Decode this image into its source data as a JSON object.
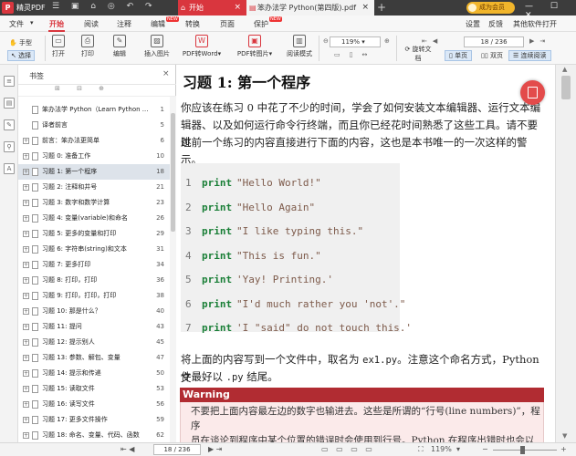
{
  "titlebar": {
    "app_logo": "P",
    "app_name": "精灵PDF",
    "tabs": [
      {
        "label": "开始",
        "close": "×"
      },
      {
        "label": "笨办法学 Python(第四版).pdf",
        "close": "×"
      }
    ],
    "new_tab": "+",
    "member_label": "成为会员",
    "window_controls": "— ☐ ✕"
  },
  "menu": {
    "items": [
      "文件",
      "开始",
      "阅读",
      "注释",
      "编辑",
      "转换",
      "页面",
      "保护"
    ],
    "right_items": [
      "设置",
      "反馈",
      "其他软件打开"
    ],
    "new_badge": "NEW"
  },
  "toolbar": {
    "hand": "手型",
    "select": "选择",
    "tools": [
      "打开",
      "打印",
      "编辑",
      "插入图片",
      "PDF转Word",
      "PDF转图片",
      "阅读模式"
    ],
    "zoom": "119%",
    "page_box": "18 / 236",
    "rotate": "旋转文档",
    "views": [
      "单页",
      "双页",
      "连续阅读"
    ]
  },
  "sidebar": {
    "title": "书签",
    "close": "×",
    "tools": "⊞ ⊟ ⊕",
    "bookmarks": [
      {
        "label": "笨办法学 Python（Learn Python ...",
        "page": "1",
        "expand": false
      },
      {
        "label": "译者前言",
        "page": "5",
        "expand": false
      },
      {
        "label": "前言：笨办法更简单",
        "page": "6",
        "expand": true
      },
      {
        "label": "习题 0: 准备工作",
        "page": "10",
        "expand": true
      },
      {
        "label": "习题 1: 第一个程序",
        "page": "18",
        "expand": true,
        "selected": true
      },
      {
        "label": "习题 2: 注释和井号",
        "page": "21",
        "expand": true
      },
      {
        "label": "习题 3: 数字和数学计算",
        "page": "23",
        "expand": true
      },
      {
        "label": "习题 4: 变量(variable)和命名",
        "page": "26",
        "expand": true
      },
      {
        "label": "习题 5: 更多的变量和打印",
        "page": "29",
        "expand": true
      },
      {
        "label": "习题 6: 字符串(string)和文本",
        "page": "31",
        "expand": true
      },
      {
        "label": "习题 7: 更多打印",
        "page": "34",
        "expand": true
      },
      {
        "label": "习题 8: 打印，打印",
        "page": "36",
        "expand": true
      },
      {
        "label": "习题 9: 打印，打印，打印",
        "page": "38",
        "expand": true
      },
      {
        "label": "习题 10: 那是什么？",
        "page": "40",
        "expand": true
      },
      {
        "label": "习题 11: 提问",
        "page": "43",
        "expand": true
      },
      {
        "label": "习题 12: 提示别人",
        "page": "45",
        "expand": true
      },
      {
        "label": "习题 13: 参数、解包、变量",
        "page": "47",
        "expand": true
      },
      {
        "label": "习题 14: 提示和传递",
        "page": "50",
        "expand": true
      },
      {
        "label": "习题 15: 读取文件",
        "page": "53",
        "expand": true
      },
      {
        "label": "习题 16: 读写文件",
        "page": "56",
        "expand": true
      },
      {
        "label": "习题 17: 更多文件操作",
        "page": "59",
        "expand": true
      },
      {
        "label": "习题 18: 命名、变量、代码、函数",
        "page": "62",
        "expand": true
      }
    ]
  },
  "document": {
    "heading": "习题 1: 第一个程序",
    "intro_lines": [
      "你应该在练习 0 中花了不少的时间，学会了如何安装文本编辑器、运行文本编",
      "辑器、以及如何运行命令行终端，而且你已经花时间熟悉了这些工具。请不要跳",
      "过前一个练习的内容直接进行下面的内容，这也是本书唯一的一次这样的警示。"
    ],
    "code_lines": [
      {
        "num": "1",
        "kw": "print",
        "str": "\"Hello World!\""
      },
      {
        "num": "2",
        "kw": "print",
        "str": "\"Hello Again\""
      },
      {
        "num": "3",
        "kw": "print",
        "str": "\"I like typing this.\""
      },
      {
        "num": "4",
        "kw": "print",
        "str": "\"This is fun.\""
      },
      {
        "num": "5",
        "kw": "print",
        "str": "'Yay! Printing.'"
      },
      {
        "num": "6",
        "kw": "print",
        "str": "\"I'd much rather you 'not'.\""
      },
      {
        "num": "7",
        "kw": "print",
        "str": "'I \"said\" do not touch this.'"
      }
    ],
    "after_line1_a": "将上面的内容写到一个文件中，取名为",
    "after_line1_code": "ex1.py",
    "after_line1_b": "。注意这个命名方式，Python 文",
    "after_line2_a": "件最好以",
    "after_line2_code": ".py",
    "after_line2_b": "结尾。",
    "warning_title": "Warning",
    "warning_lines": [
      "不要把上面内容最左边的数字也输进去。这些是所谓的“行号(line numbers)”，程序",
      "员在谈论到程序中某个位置的错误时会使用到行号。Python 在程序出错时也会以"
    ]
  },
  "statusbar": {
    "nav_left": "⇤  ◀",
    "page": "18 / 236",
    "nav_right": "▶  ⇥",
    "right_icons": "▭ ▭ ▭ ▭",
    "zoom": "119%",
    "zoom_minus": "−",
    "zoom_plus": "+"
  },
  "colors": {
    "accent": "#d9363e",
    "selection": "#dde3ea",
    "warning": "#b12c32"
  }
}
